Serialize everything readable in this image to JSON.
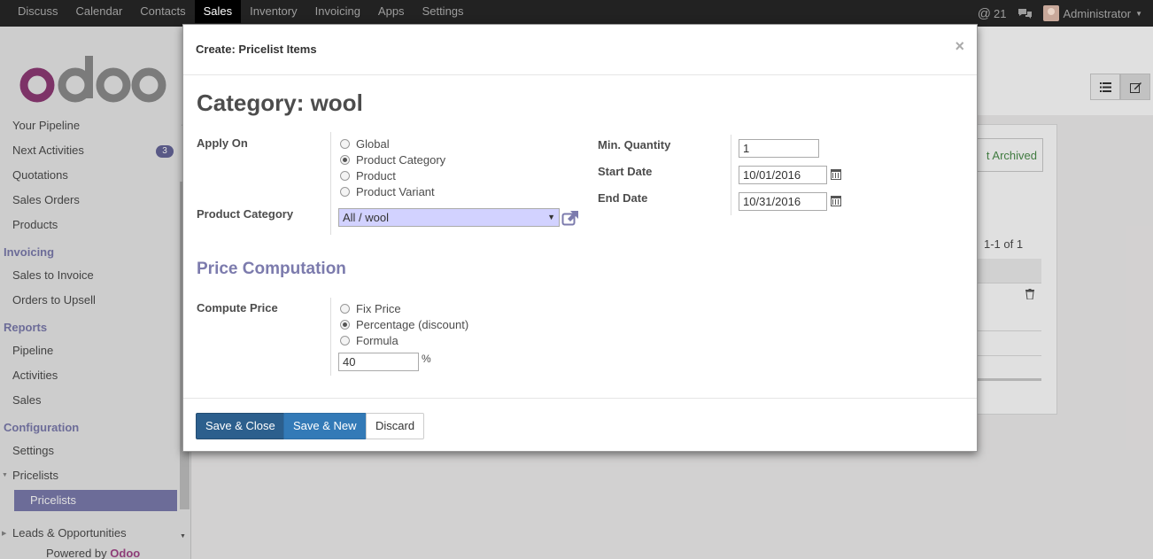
{
  "topnav": {
    "items": [
      "Discuss",
      "Calendar",
      "Contacts",
      "Sales",
      "Inventory",
      "Invoicing",
      "Apps",
      "Settings"
    ],
    "active": "Sales",
    "notifications": "21",
    "user": "Administrator"
  },
  "sidebar": {
    "items": [
      {
        "label": "Your Pipeline"
      },
      {
        "label": "Next Activities",
        "badge": "3"
      },
      {
        "label": "Quotations"
      },
      {
        "label": "Sales Orders"
      },
      {
        "label": "Products"
      }
    ],
    "invoicing_header": "Invoicing",
    "invoicing_items": [
      "Sales to Invoice",
      "Orders to Upsell"
    ],
    "reports_header": "Reports",
    "reports_items": [
      "Pipeline",
      "Activities",
      "Sales"
    ],
    "config_header": "Configuration",
    "config_items": [
      "Settings",
      "Pricelists"
    ],
    "active_item": "Pricelists",
    "leads_item": "Leads & Opportunities",
    "powered_prefix": "Powered by",
    "powered_brand": "Odoo"
  },
  "background": {
    "archived_label": "t Archived",
    "pager": "1-1 of 1"
  },
  "modal": {
    "title": "Create: Pricelist Items",
    "close": "×",
    "record_title": "Category: wool",
    "apply_on": {
      "label": "Apply On",
      "options": [
        "Global",
        "Product Category",
        "Product",
        "Product Variant"
      ],
      "selected": "Product Category"
    },
    "product_category": {
      "label": "Product Category",
      "value": "All / wool"
    },
    "min_quantity": {
      "label": "Min. Quantity",
      "value": "1"
    },
    "start_date": {
      "label": "Start Date",
      "value": "10/01/2016"
    },
    "end_date": {
      "label": "End Date",
      "value": "10/31/2016"
    },
    "price_section": "Price Computation",
    "compute_price": {
      "label": "Compute Price",
      "options": [
        "Fix Price",
        "Percentage (discount)",
        "Formula"
      ],
      "selected": "Percentage (discount)",
      "value": "40",
      "unit": "%"
    },
    "buttons": {
      "save_close": "Save & Close",
      "save_new": "Save & New",
      "discard": "Discard"
    }
  },
  "colors": {
    "accent": "#7c7bad",
    "primary_button": "#2c5f8d",
    "secondary_button": "#337ab7",
    "brand": "#a24689"
  }
}
